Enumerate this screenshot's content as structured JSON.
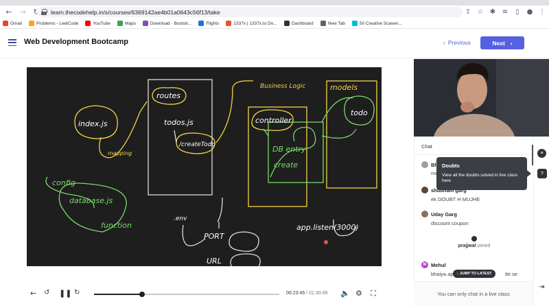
{
  "browser": {
    "url": "learn.thecodehelp.in/s/courses/6369142ae4b01a0643c56f13/take",
    "bookmarks": [
      {
        "label": "Gmail",
        "color": "#ea4335"
      },
      {
        "label": "Problems - LeetCode",
        "color": "#ffa116"
      },
      {
        "label": "YouTube",
        "color": "#ff0000"
      },
      {
        "label": "Maps",
        "color": "#34a853"
      },
      {
        "label": "Download · Bootstr...",
        "color": "#7952b3"
      },
      {
        "label": "Flights",
        "color": "#1a73e8"
      },
      {
        "label": "1337x | 1337x.to Do...",
        "color": "#e8542c"
      },
      {
        "label": "Dashboard",
        "color": "#333333"
      },
      {
        "label": "New Tab",
        "color": "#5f6368"
      },
      {
        "label": "50 Creative Scaven...",
        "color": "#00bcd4"
      }
    ]
  },
  "header": {
    "title": "Web Development Bootcamp",
    "prev_label": "Previous",
    "next_label": "Next"
  },
  "video": {
    "handwriting": {
      "index": "index.js",
      "routes": "routes",
      "todos": "todos.js",
      "create": "/createTodo",
      "business": "Business Logic",
      "models": "models",
      "controller": "controller",
      "todo": "todo",
      "db": "DB entry",
      "create2": "create",
      "config": "config",
      "database": "database.js",
      "function": "function",
      "mapping": "mapping",
      "env": ".env",
      "port": "PORT",
      "url": "URL",
      "app_listen": "app.listen(3000)"
    },
    "current_time": "00:23:45",
    "separator": "/",
    "duration": "01:30:49",
    "progress": 0.26
  },
  "chat": {
    "title": "Chat",
    "messages": [
      {
        "name": "Bh",
        "text": "mo",
        "avatar": "#9aa0a6"
      },
      {
        "name": "shubham garg",
        "text": "ek DOUBT H MUJHE",
        "avatar": "#5a4636"
      },
      {
        "name": "Uday Garg",
        "text": "discount coupon",
        "avatar": "#8d6e63"
      },
      {
        "name": "Mehul",
        "text": "bhaiya ap",
        "text_tail": "tle se",
        "avatar": "#ab47bc",
        "initial": "M"
      }
    ],
    "joined_name": "prajjwal",
    "joined_text": "joined",
    "tooltip_title": "Doubts",
    "tooltip_text": "View all the doubts solved in live class here",
    "jump_label": "↓ JUMP TO LATEST",
    "footer": "You can only chat in a live class"
  }
}
